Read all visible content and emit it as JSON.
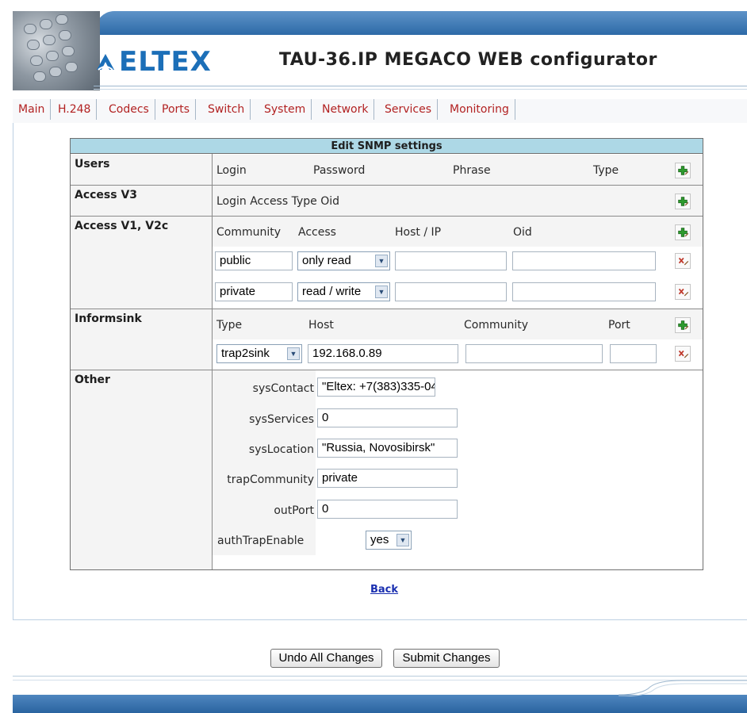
{
  "header": {
    "brand": "ELTEX",
    "app_title": "TAU-36.IP MEGACO WEB configurator"
  },
  "nav": [
    "Main",
    "H.248",
    "Codecs",
    "Ports",
    "Switch",
    "System",
    "Network",
    "Services",
    "Monitoring"
  ],
  "table": {
    "title": "Edit SNMP settings",
    "users": {
      "label": "Users",
      "headers": [
        "Login",
        "Password",
        "Phrase",
        "Type"
      ]
    },
    "access_v3": {
      "label": "Access V3",
      "headers_text": "Login Access Type Oid"
    },
    "access_v1v2c": {
      "label": "Access V1, V2c",
      "headers": [
        "Community",
        "Access",
        "Host / IP",
        "Oid"
      ],
      "rows": [
        {
          "community": "public",
          "access": "only read",
          "host": "",
          "oid": ""
        },
        {
          "community": "private",
          "access": "read / write",
          "host": "",
          "oid": ""
        }
      ]
    },
    "informsink": {
      "label": "Informsink",
      "headers": [
        "Type",
        "Host",
        "Community",
        "Port"
      ],
      "rows": [
        {
          "type": "trap2sink",
          "host": "192.168.0.89",
          "community": "",
          "port": ""
        }
      ]
    },
    "other": {
      "label": "Other",
      "fields": [
        {
          "label": "sysContact",
          "value": "\"Eltex: +7(383)335-04"
        },
        {
          "label": "sysServices",
          "value": "0"
        },
        {
          "label": "sysLocation",
          "value": "\"Russia, Novosibirsk\""
        },
        {
          "label": "trapCommunity",
          "value": "private"
        },
        {
          "label": "outPort",
          "value": "0"
        }
      ],
      "auth_trap": {
        "label": "authTrapEnable",
        "value": "yes"
      }
    }
  },
  "back_link": "Back",
  "buttons": {
    "undo": "Undo All Changes",
    "submit": "Submit Changes"
  },
  "colors": {
    "header_blue": "#2d6aa7",
    "nav_red": "#b22222",
    "table_title_bg": "#add8e6",
    "brand_blue": "#1c6fb8"
  },
  "icons": {
    "add": "add-icon",
    "delete": "delete-icon"
  }
}
